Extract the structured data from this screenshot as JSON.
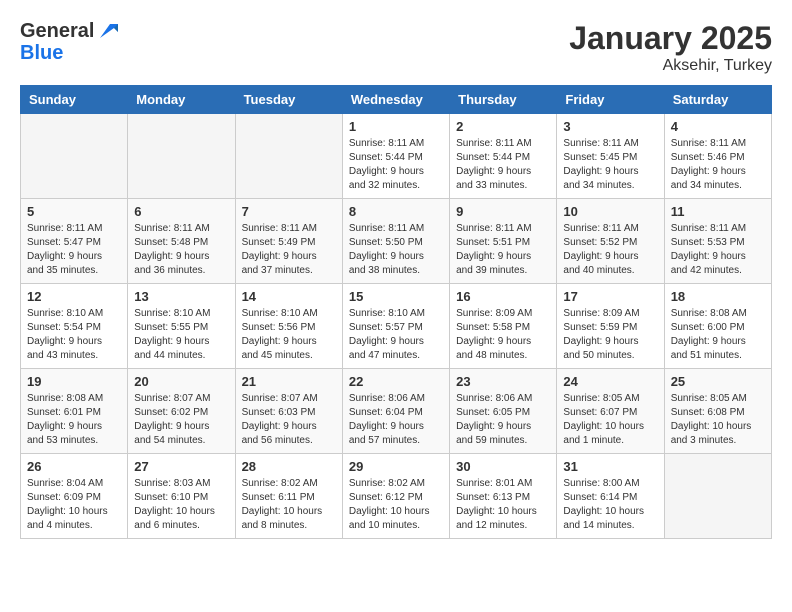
{
  "header": {
    "logo_line1": "General",
    "logo_line2": "Blue",
    "month": "January 2025",
    "location": "Aksehir, Turkey"
  },
  "days_of_week": [
    "Sunday",
    "Monday",
    "Tuesday",
    "Wednesday",
    "Thursday",
    "Friday",
    "Saturday"
  ],
  "weeks": [
    [
      {
        "day": "",
        "info": ""
      },
      {
        "day": "",
        "info": ""
      },
      {
        "day": "",
        "info": ""
      },
      {
        "day": "1",
        "info": "Sunrise: 8:11 AM\nSunset: 5:44 PM\nDaylight: 9 hours and 32 minutes."
      },
      {
        "day": "2",
        "info": "Sunrise: 8:11 AM\nSunset: 5:44 PM\nDaylight: 9 hours and 33 minutes."
      },
      {
        "day": "3",
        "info": "Sunrise: 8:11 AM\nSunset: 5:45 PM\nDaylight: 9 hours and 34 minutes."
      },
      {
        "day": "4",
        "info": "Sunrise: 8:11 AM\nSunset: 5:46 PM\nDaylight: 9 hours and 34 minutes."
      }
    ],
    [
      {
        "day": "5",
        "info": "Sunrise: 8:11 AM\nSunset: 5:47 PM\nDaylight: 9 hours and 35 minutes."
      },
      {
        "day": "6",
        "info": "Sunrise: 8:11 AM\nSunset: 5:48 PM\nDaylight: 9 hours and 36 minutes."
      },
      {
        "day": "7",
        "info": "Sunrise: 8:11 AM\nSunset: 5:49 PM\nDaylight: 9 hours and 37 minutes."
      },
      {
        "day": "8",
        "info": "Sunrise: 8:11 AM\nSunset: 5:50 PM\nDaylight: 9 hours and 38 minutes."
      },
      {
        "day": "9",
        "info": "Sunrise: 8:11 AM\nSunset: 5:51 PM\nDaylight: 9 hours and 39 minutes."
      },
      {
        "day": "10",
        "info": "Sunrise: 8:11 AM\nSunset: 5:52 PM\nDaylight: 9 hours and 40 minutes."
      },
      {
        "day": "11",
        "info": "Sunrise: 8:11 AM\nSunset: 5:53 PM\nDaylight: 9 hours and 42 minutes."
      }
    ],
    [
      {
        "day": "12",
        "info": "Sunrise: 8:10 AM\nSunset: 5:54 PM\nDaylight: 9 hours and 43 minutes."
      },
      {
        "day": "13",
        "info": "Sunrise: 8:10 AM\nSunset: 5:55 PM\nDaylight: 9 hours and 44 minutes."
      },
      {
        "day": "14",
        "info": "Sunrise: 8:10 AM\nSunset: 5:56 PM\nDaylight: 9 hours and 45 minutes."
      },
      {
        "day": "15",
        "info": "Sunrise: 8:10 AM\nSunset: 5:57 PM\nDaylight: 9 hours and 47 minutes."
      },
      {
        "day": "16",
        "info": "Sunrise: 8:09 AM\nSunset: 5:58 PM\nDaylight: 9 hours and 48 minutes."
      },
      {
        "day": "17",
        "info": "Sunrise: 8:09 AM\nSunset: 5:59 PM\nDaylight: 9 hours and 50 minutes."
      },
      {
        "day": "18",
        "info": "Sunrise: 8:08 AM\nSunset: 6:00 PM\nDaylight: 9 hours and 51 minutes."
      }
    ],
    [
      {
        "day": "19",
        "info": "Sunrise: 8:08 AM\nSunset: 6:01 PM\nDaylight: 9 hours and 53 minutes."
      },
      {
        "day": "20",
        "info": "Sunrise: 8:07 AM\nSunset: 6:02 PM\nDaylight: 9 hours and 54 minutes."
      },
      {
        "day": "21",
        "info": "Sunrise: 8:07 AM\nSunset: 6:03 PM\nDaylight: 9 hours and 56 minutes."
      },
      {
        "day": "22",
        "info": "Sunrise: 8:06 AM\nSunset: 6:04 PM\nDaylight: 9 hours and 57 minutes."
      },
      {
        "day": "23",
        "info": "Sunrise: 8:06 AM\nSunset: 6:05 PM\nDaylight: 9 hours and 59 minutes."
      },
      {
        "day": "24",
        "info": "Sunrise: 8:05 AM\nSunset: 6:07 PM\nDaylight: 10 hours and 1 minute."
      },
      {
        "day": "25",
        "info": "Sunrise: 8:05 AM\nSunset: 6:08 PM\nDaylight: 10 hours and 3 minutes."
      }
    ],
    [
      {
        "day": "26",
        "info": "Sunrise: 8:04 AM\nSunset: 6:09 PM\nDaylight: 10 hours and 4 minutes."
      },
      {
        "day": "27",
        "info": "Sunrise: 8:03 AM\nSunset: 6:10 PM\nDaylight: 10 hours and 6 minutes."
      },
      {
        "day": "28",
        "info": "Sunrise: 8:02 AM\nSunset: 6:11 PM\nDaylight: 10 hours and 8 minutes."
      },
      {
        "day": "29",
        "info": "Sunrise: 8:02 AM\nSunset: 6:12 PM\nDaylight: 10 hours and 10 minutes."
      },
      {
        "day": "30",
        "info": "Sunrise: 8:01 AM\nSunset: 6:13 PM\nDaylight: 10 hours and 12 minutes."
      },
      {
        "day": "31",
        "info": "Sunrise: 8:00 AM\nSunset: 6:14 PM\nDaylight: 10 hours and 14 minutes."
      },
      {
        "day": "",
        "info": ""
      }
    ]
  ]
}
